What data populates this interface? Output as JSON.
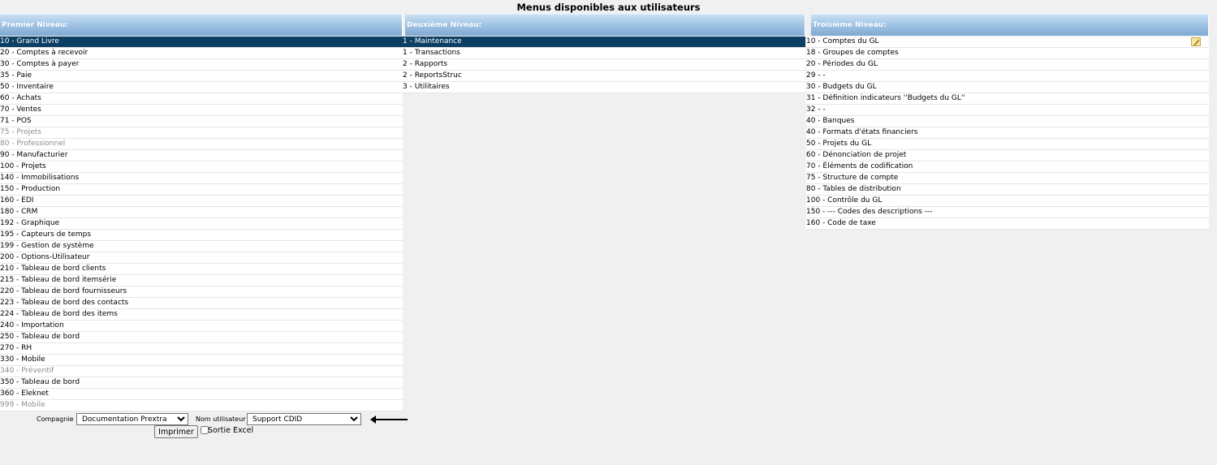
{
  "title": "Menus disponibles aux utilisateurs",
  "columns": [
    {
      "header": "Premier Niveau:",
      "items": [
        {
          "label": "10 - Grand Livre",
          "state": "selected"
        },
        {
          "label": "20 - Comptes à recevoir",
          "state": "normal"
        },
        {
          "label": "30 - Comptes à payer",
          "state": "normal"
        },
        {
          "label": "35 - Paie",
          "state": "normal"
        },
        {
          "label": "50 - Inventaire",
          "state": "normal"
        },
        {
          "label": "60 - Achats",
          "state": "normal"
        },
        {
          "label": "70 - Ventes",
          "state": "normal"
        },
        {
          "label": "71 - POS",
          "state": "normal"
        },
        {
          "label": "75 - Projets",
          "state": "disabled"
        },
        {
          "label": "80 - Professionnel",
          "state": "disabled"
        },
        {
          "label": "90 - Manufacturier",
          "state": "normal"
        },
        {
          "label": "100 - Projets",
          "state": "normal"
        },
        {
          "label": "140 - Immobilisations",
          "state": "normal"
        },
        {
          "label": "150 - Production",
          "state": "normal"
        },
        {
          "label": "160 - EDI",
          "state": "normal"
        },
        {
          "label": "180 - CRM",
          "state": "normal"
        },
        {
          "label": "192 - Graphique",
          "state": "normal"
        },
        {
          "label": "195 - Capteurs de temps",
          "state": "normal"
        },
        {
          "label": "199 - Gestion de système",
          "state": "normal"
        },
        {
          "label": "200 - Options-Utilisateur",
          "state": "normal"
        },
        {
          "label": "210 - Tableau de bord clients",
          "state": "normal"
        },
        {
          "label": "215 - Tableau de bord itemsérie",
          "state": "normal"
        },
        {
          "label": "220 - Tableau de bord fournisseurs",
          "state": "normal"
        },
        {
          "label": "223 - Tableau de bord des contacts",
          "state": "normal"
        },
        {
          "label": "224 - Tableau de bord des items",
          "state": "normal"
        },
        {
          "label": "240 - Importation",
          "state": "normal"
        },
        {
          "label": "250 - Tableau de bord",
          "state": "normal"
        },
        {
          "label": "270 - RH",
          "state": "normal"
        },
        {
          "label": "330 - Mobile",
          "state": "normal"
        },
        {
          "label": "340 - Préventif",
          "state": "disabled"
        },
        {
          "label": "350 - Tableau de bord",
          "state": "normal"
        },
        {
          "label": "360 - Eleknet",
          "state": "normal"
        },
        {
          "label": "999 - Mobile",
          "state": "disabled"
        }
      ]
    },
    {
      "header": "Deuxième Niveau:",
      "items": [
        {
          "label": "1 - Maintenance",
          "state": "selected"
        },
        {
          "label": "1 - Transactions",
          "state": "normal"
        },
        {
          "label": "2 - Rapports",
          "state": "normal"
        },
        {
          "label": "2 - ReportsStruc",
          "state": "normal"
        },
        {
          "label": "3 - Utilitaires",
          "state": "normal"
        }
      ]
    },
    {
      "header": "Troisième Niveau:",
      "items": [
        {
          "label": "10 - Comptes du GL",
          "state": "normal"
        },
        {
          "label": "18 - Groupes de comptes",
          "state": "normal"
        },
        {
          "label": "20 - Périodes du GL",
          "state": "normal"
        },
        {
          "label": "29 - -",
          "state": "normal"
        },
        {
          "label": "30 - Budgets du GL",
          "state": "normal"
        },
        {
          "label": "31 - Définition indicateurs ''Budgets du GL''",
          "state": "normal"
        },
        {
          "label": "32 - -",
          "state": "normal"
        },
        {
          "label": "40 - Banques",
          "state": "normal"
        },
        {
          "label": "40 - Formats d'états financiers",
          "state": "normal"
        },
        {
          "label": "50 - Projets du GL",
          "state": "normal"
        },
        {
          "label": "60 - Dénonciation de projet",
          "state": "normal"
        },
        {
          "label": "70 - Éléments de codification",
          "state": "normal"
        },
        {
          "label": "75 - Structure de compte",
          "state": "normal"
        },
        {
          "label": "80 - Tables de distribution",
          "state": "normal"
        },
        {
          "label": "100 - Contrôle du GL",
          "state": "normal"
        },
        {
          "label": "150 - --- Codes des descriptions ---",
          "state": "normal"
        },
        {
          "label": "160 - Code de taxe",
          "state": "normal"
        }
      ]
    }
  ],
  "form": {
    "company_label": "Compagnie :",
    "company_value": "Documentation Prextra",
    "user_label": "Nom utilisateur :",
    "user_value": "Support CDID",
    "print_label": "Imprimer",
    "excel_label": "Sortie Excel"
  },
  "icons": {
    "edit": "edit-icon",
    "arrow": "arrow-left-icon"
  },
  "colors": {
    "header_gradient_top": "#c9e0f3",
    "header_gradient_bottom": "#7fa9d2",
    "selected_row": "#0c3f64",
    "disabled_text": "#8c8c8c"
  }
}
